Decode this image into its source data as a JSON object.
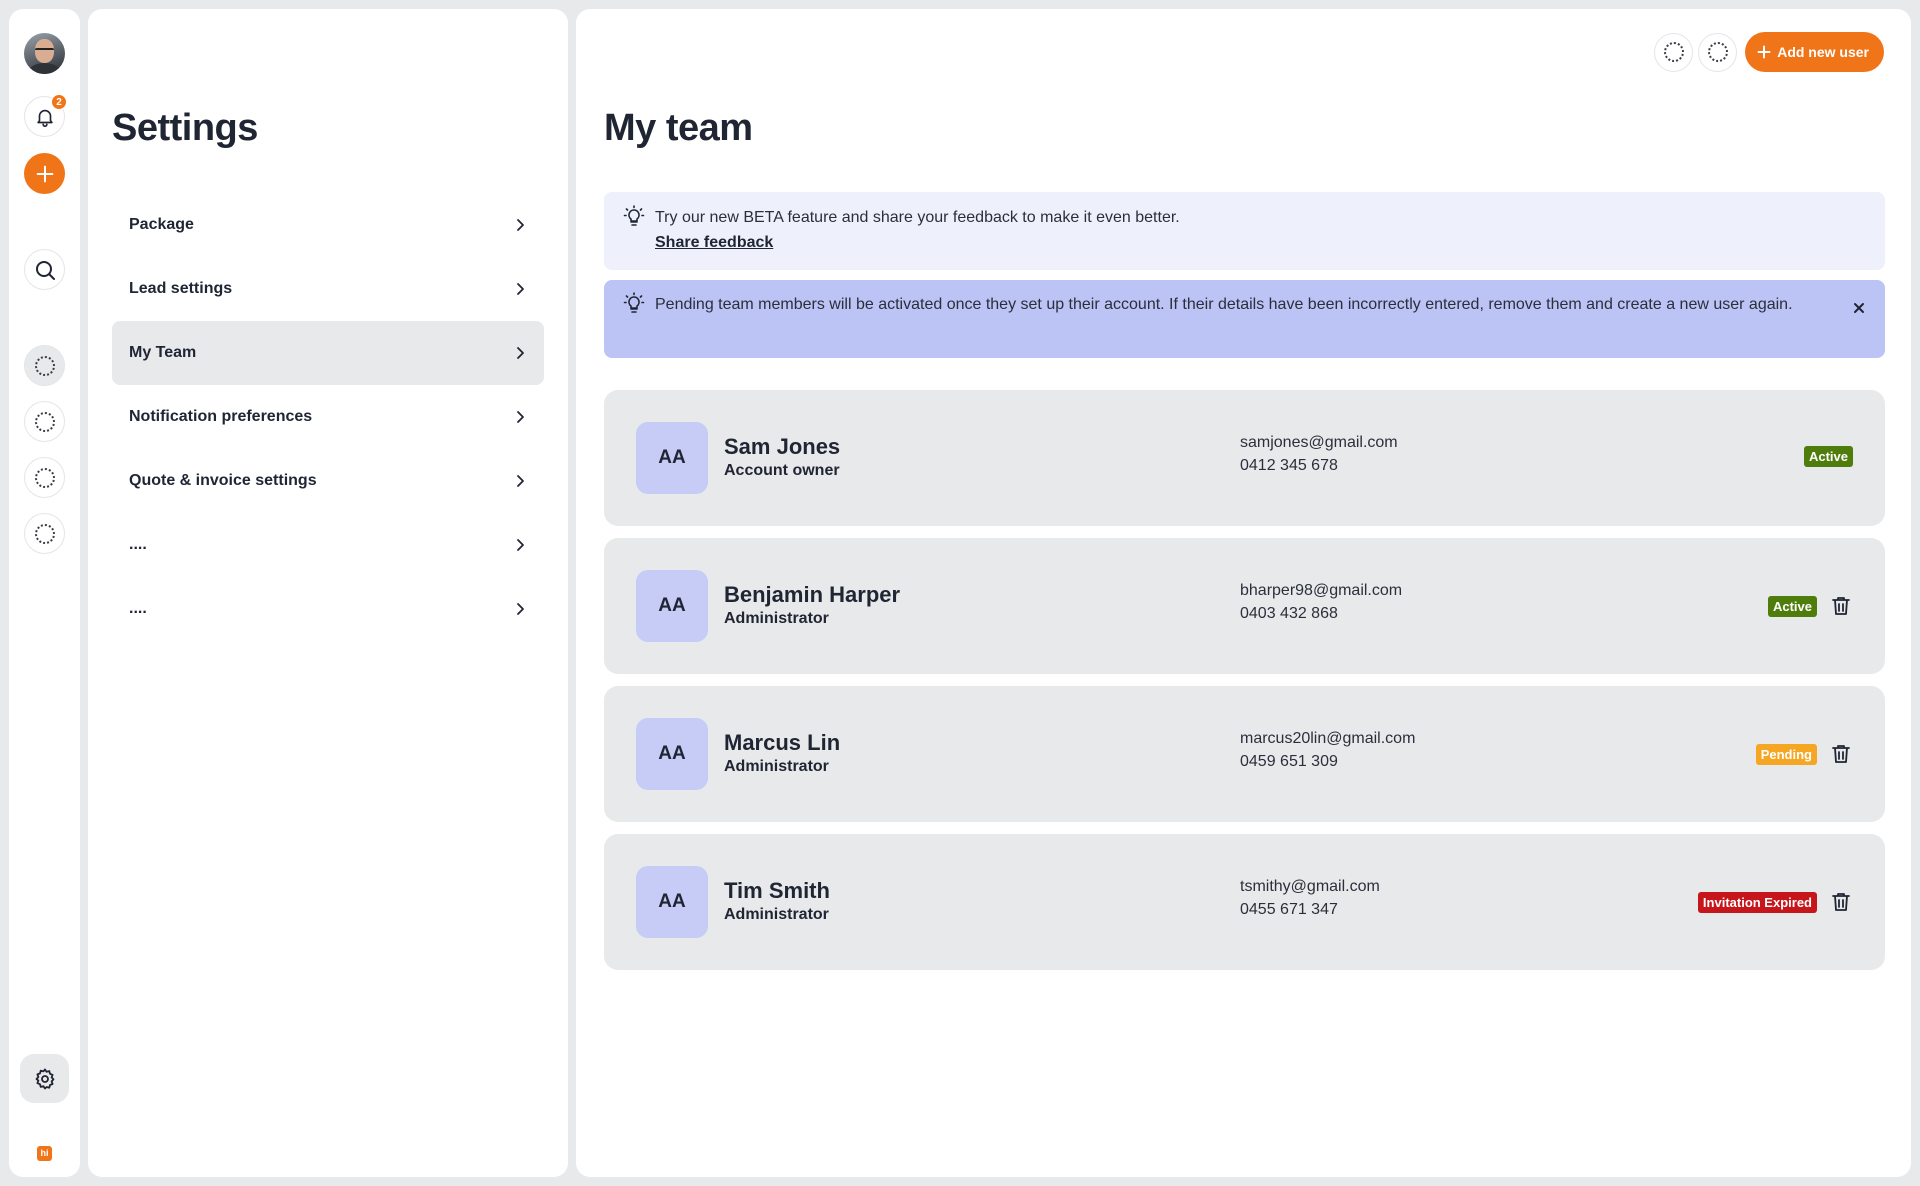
{
  "rail": {
    "notification_count": "2",
    "logo_text": "hi",
    "icons": [
      "avatar",
      "bell-icon",
      "plus-icon",
      "search-icon",
      "placeholder-icon",
      "gear-icon"
    ]
  },
  "settings": {
    "title": "Settings",
    "items": [
      {
        "label": "Package"
      },
      {
        "label": "Lead settings"
      },
      {
        "label": "My Team"
      },
      {
        "label": "Notification preferences"
      },
      {
        "label": "Quote & invoice settings"
      },
      {
        "label": "...."
      },
      {
        "label": "...."
      }
    ],
    "active_item": "My Team"
  },
  "main": {
    "title": "My team",
    "add_user_label": "Add new user",
    "beta_banner": {
      "text": "Try our new BETA feature and share your feedback to make it even better.",
      "link": "Share feedback"
    },
    "pending_banner": {
      "text": "Pending team members will be activated once they set up their account. If their details have been incorrectly entered, remove them and create a new user again."
    },
    "members": [
      {
        "initials": "AA",
        "name": "Sam Jones",
        "role": "Account owner",
        "email": "samjones@gmail.com",
        "phone": "0412 345 678",
        "status": "Active",
        "status_color": "#4f7d0c",
        "deletable": false
      },
      {
        "initials": "AA",
        "name": "Benjamin Harper",
        "role": "Administrator",
        "email": "bharper98@gmail.com",
        "phone": "0403 432 868",
        "status": "Active",
        "status_color": "#4f7d0c",
        "deletable": true
      },
      {
        "initials": "AA",
        "name": "Marcus Lin",
        "role": "Administrator",
        "email": "marcus20lin@gmail.com",
        "phone": "0459 651 309",
        "status": "Pending",
        "status_color": "#f5a623",
        "deletable": true
      },
      {
        "initials": "AA",
        "name": "Tim Smith",
        "role": "Administrator",
        "email": "tsmithy@gmail.com",
        "phone": "0455 671 347",
        "status": "Invitation Expired",
        "status_color": "#c7161b",
        "deletable": true
      }
    ]
  },
  "colors": {
    "accent": "#f07518",
    "background": "#e8e9eb",
    "beta_banner": "#eef1fc",
    "pending_banner": "#bcc3f5",
    "avatar_bg": "#c7ccf7"
  }
}
